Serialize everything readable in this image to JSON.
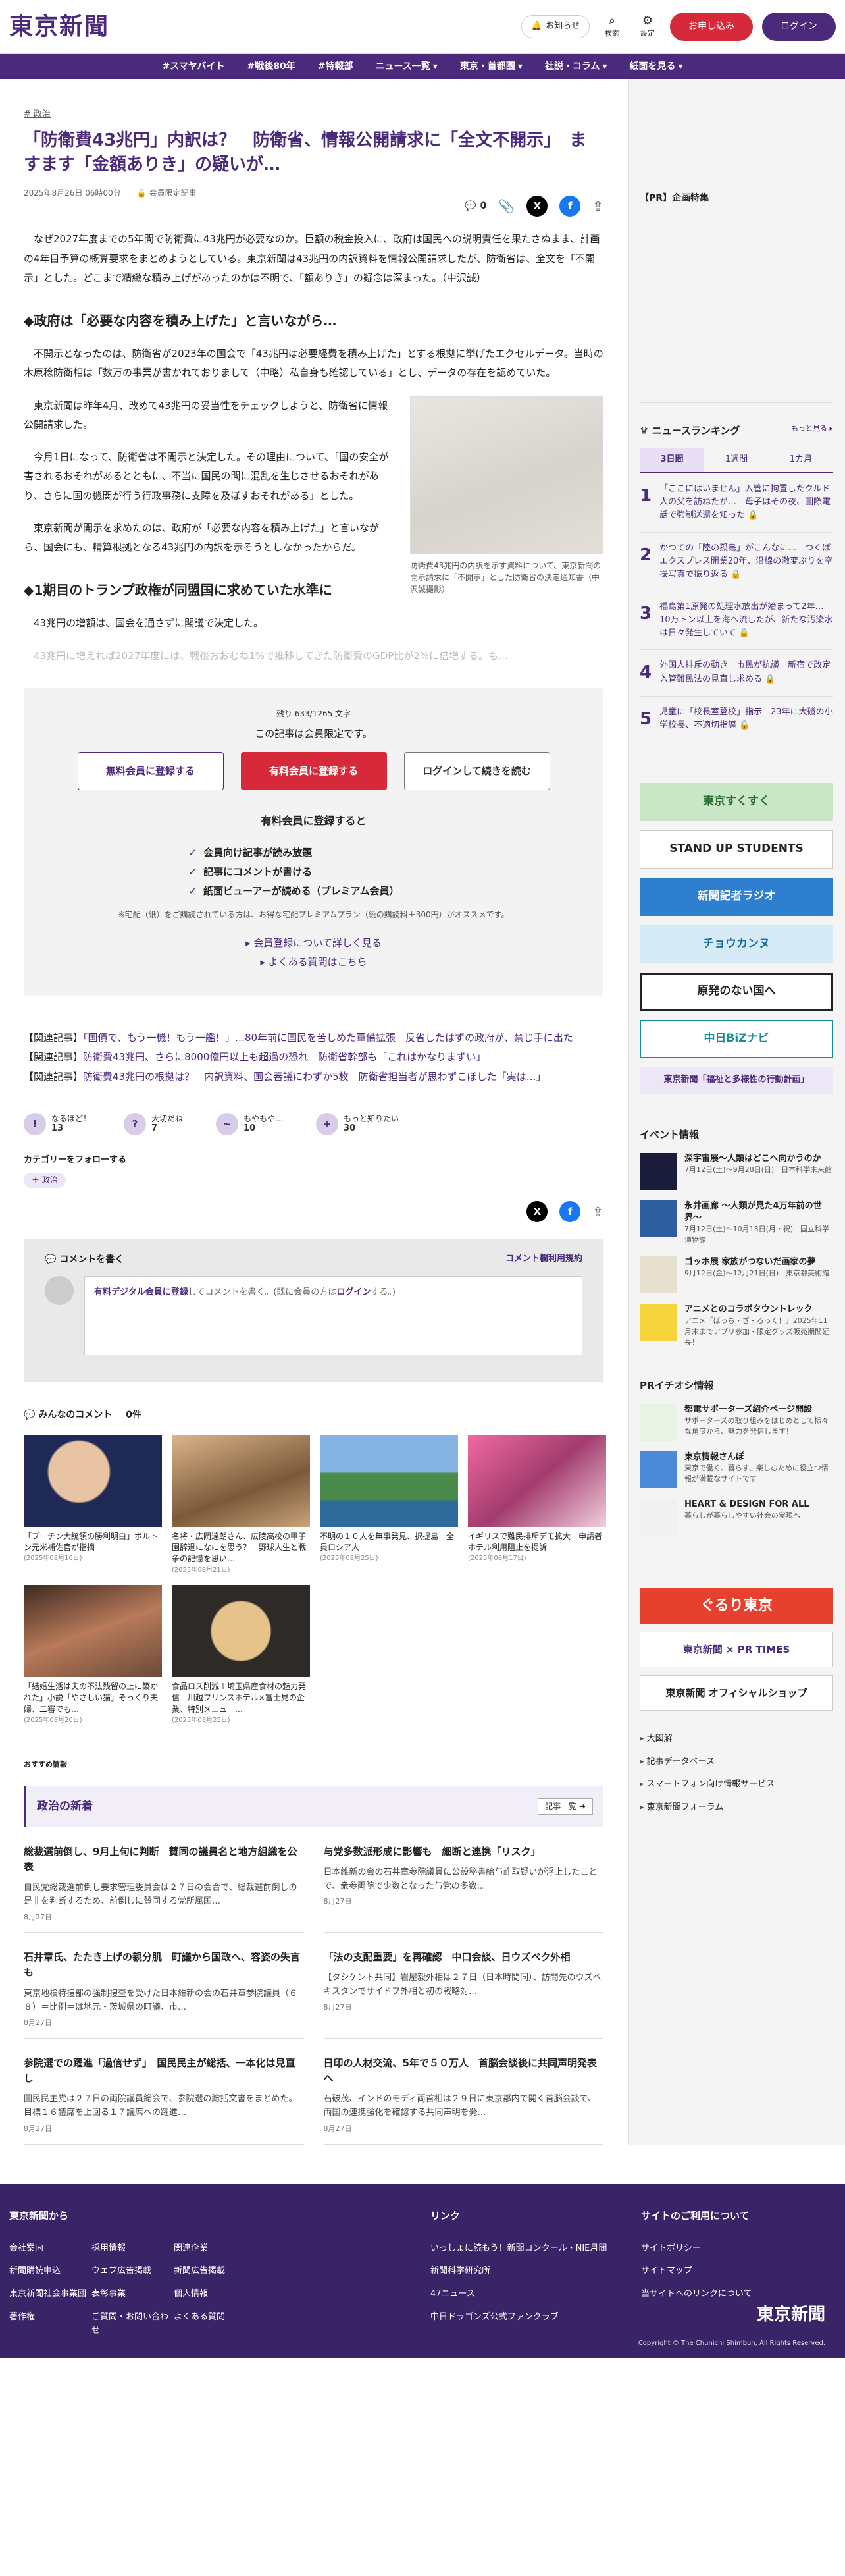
{
  "header": {
    "logo": "東京新聞",
    "notice": "お知らせ",
    "search": "検索",
    "settings": "設定",
    "register": "お申し込み",
    "login": "ログイン"
  },
  "nav": [
    "#スマヤバイト",
    "#戦後80年",
    "#特報部",
    "ニュース一覧",
    "東京・首都圏",
    "社説・コラム",
    "紙面を見る"
  ],
  "article": {
    "category": "政治",
    "title": "「防衛費43兆円」内訳は？　防衛省、情報公開請求に「全文不開示」　ますます「金額ありき」の疑いが…",
    "date": "2025年8月26日 06時00分",
    "members_only": "会員限定記事",
    "comment_count": "0",
    "lead": "なぜ2027年度までの5年間で防衛費に43兆円が必要なのか。巨額の税金投入に、政府は国民への説明責任を果たさぬまま、計画の4年目予算の概算要求をまとめようとしている。東京新聞は43兆円の内訳資料を情報公開請求したが、防衛省は、全文を「不開示」とした。どこまで精緻な積み上げがあったのかは不明で、「額ありき」の疑念は深まった。（中沢誠）",
    "h1": "◆政府は「必要な内容を積み上げた」と言いながら…",
    "p1": "不開示となったのは、防衛省が2023年の国会で「43兆円は必要経費を積み上げた」とする根拠に挙げたエクセルデータ。当時の木原稔防衛相は「数万の事業が書かれておりまして（中略）私自身も確認している」とし、データの存在を認めていた。",
    "p2": "東京新聞は昨年4月、改めて43兆円の妥当性をチェックしようと、防衛省に情報公開請求した。",
    "p3": "今月1日になって、防衛省は不開示と決定した。その理由について、「国の安全が害されるおそれがあるとともに、不当に国民の間に混乱を生じさせるおそれがあり、さらに国の機関が行う行政事務に支障を及ぼすおそれがある」とした。",
    "p4": "東京新聞が開示を求めたのは、政府が「必要な内容を積み上げた」と言いながら、国会にも、精算根拠となる43兆円の内訳を示そうとしなかったからだ。",
    "h2": "◆1期目のトランプ政権が同盟国に求めていた水準に",
    "p5": "43兆円の増額は、国会を通さずに閣議で決定した。",
    "p6": "43兆円に増えれば2027年度には、戦後おおむね1%で推移してきた防衛費のGDP比が2%に倍増する。も…",
    "figure_caption": "防衛費43兆円の内訳を示す資料について、東京新聞の開示請求に「不開示」とした防衛省の決定通知書（中沢誠撮影）"
  },
  "paywall": {
    "remaining": "残り 633/1265 文字",
    "title": "この記事は会員限定です。",
    "btn_free": "無料会員に登録する",
    "btn_paid": "有料会員に登録する",
    "btn_login": "ログインして続きを読む",
    "heading": "有料会員に登録すると",
    "benefits": [
      "会員向け記事が読み放題",
      "記事にコメントが書ける",
      "紙面ビューアーが読める（プレミアム会員）"
    ],
    "note": "※宅配（紙）をご購読されている方は、お得な宅配プレミアムプラン（紙の購読料＋300円）がオススメです。",
    "link1": "▸ 会員登録について詳しく見る",
    "link2": "▸ よくある質問はこちら"
  },
  "related": [
    {
      "prefix": "【関連記事】",
      "text": "「国債で、もう一機！もう一艦！」…80年前に国民を苦しめた軍備拡張　反省したはずの政府が、禁じ手に出た"
    },
    {
      "prefix": "【関連記事】",
      "text": "防衛費43兆円、さらに8000億円以上も超過の恐れ　防衛省幹部も「これはかなりまずい」"
    },
    {
      "prefix": "【関連記事】",
      "text": "防衛費43兆円の根拠は？　内訳資料、国会審議にわずか5枚　防衛省担当者が思わずこぼした「実は…」"
    }
  ],
  "reactions": [
    {
      "icon": "!",
      "label": "なるほど！",
      "count": "13"
    },
    {
      "icon": "?",
      "label": "大切だね",
      "count": "7"
    },
    {
      "icon": "~",
      "label": "もやもや…",
      "count": "10"
    },
    {
      "icon": "+",
      "label": "もっと知りたい",
      "count": "30"
    }
  ],
  "follow": {
    "title": "カテゴリーをフォローする",
    "chip": "＋ 政治"
  },
  "comment_box": {
    "title": "コメントを書く",
    "rules": "コメント欄利用規約",
    "prompt_strong": "有料デジタル会員に登録",
    "prompt_mid": "してコメントを書く。(既に会員の方は",
    "prompt_login": "ログイン",
    "prompt_end": "する。)"
  },
  "all_comments": {
    "label": "みんなのコメント",
    "count": "0件"
  },
  "photos": [
    {
      "caption": "「プーチン大統領の勝利明白」ボルトン元米補佐官が指摘",
      "date": "(2025年08月16日)"
    },
    {
      "caption": "名将・広岡達朗さん、広陵高校の甲子園辞退になにを思う？　野球人生と戦争の記憶を思い…",
      "date": "(2025年08月21日)"
    },
    {
      "caption": "不明の１０人を無事発見、択捉島　全員ロシア人",
      "date": "(2025年08月25日)"
    },
    {
      "caption": "イギリスで難民排斥デモ拡大　申請者ホテル利用阻止を提訴",
      "date": "(2025年08月17日)"
    },
    {
      "caption": "「結婚生活は夫の不法残留の上に築かれた」小説「やさしい猫」そっくり夫婦、二審でも…",
      "date": "(2025年08月20日)"
    },
    {
      "caption": "食品ロス削減＋埼玉県産食材の魅力発信　川越プリンスホテル×富士見の企業、特別メニュー…",
      "date": "(2025年08月25日)"
    }
  ],
  "reco_label": "おすすめ情報",
  "politics": {
    "title": "政治の新着",
    "more": "記事一覧 ➜",
    "items": [
      {
        "title": "総裁選前倒し、9月上旬に判断　賛同の議員名と地方組織を公表",
        "text": "自民党総裁選前倒し要求管理委員会は２７日の会合で、総裁選前倒しの是非を判断するため、前倒しに賛同する党所属国…",
        "date": "8月27日"
      },
      {
        "title": "与党多数派形成に影響も　細断と連携「リスク」",
        "text": "日本維新の会の石井章参院議員に公設秘書給与詐取疑いが浮上したことで、衆参両院で少数となった与党の多数…",
        "date": "8月27日"
      },
      {
        "title": "石井章氏、たたき上げの親分肌　町議から国政へ、容姿の失言も",
        "text": "東京地検特捜部の強制捜査を受けた日本維新の会の石井章参院議員（６８）＝比例＝は地元・茨城県の町議、市…",
        "date": "8月27日"
      },
      {
        "title": "「法の支配重要」を再確認　中口会談、日ウズベク外相",
        "text": "【タシケント共同】岩屋毅外相は２７日（日本時間同）、訪問先のウズベキスタンでサイドフ外相と初の戦略対…",
        "date": "8月27日"
      },
      {
        "title": "参院選での躍進「過信せず」　国民民主が総括、一本化は見直し",
        "text": "国民民主党は２７日の両院議員総会で、参院選の総括文書をまとめた。目標１６議席を上回る１７議席への躍進…",
        "date": "8月27日"
      },
      {
        "title": "日印の人材交流、5年で５０万人　首脳会談後に共同声明発表へ",
        "text": "石破茂、インドのモディ両首相は２９日に東京都内で開く首脳会談で、両国の連携強化を確認する共同声明を発…",
        "date": "8月27日"
      }
    ]
  },
  "sidebar": {
    "pr_title": "【PR】企画特集",
    "ranking_title": "ニュースランキング",
    "ranking_more": "もっと見る ▸",
    "tabs": [
      "3日間",
      "1週間",
      "1カ月"
    ],
    "ranking": [
      {
        "n": "1",
        "t": "「ここにはいません」入管に拘置したクルド人の父を訪ねたが…　母子はその夜、国際電話で強制送還を知った 🔒"
      },
      {
        "n": "2",
        "t": "かつての「陸の孤島」がこんなに…　つくばエクスプレス開業20年、沿線の激変ぶりを空撮写真で振り返る 🔒"
      },
      {
        "n": "3",
        "t": "福島第1原発の処理水放出が始まって2年…10万トン以上を海へ流したが、新たな汚染水は日々発生していて 🔒"
      },
      {
        "n": "4",
        "t": "外国人排斥の動き　市民が抗議　新宿で改定入管難民法の見直し求める 🔒"
      },
      {
        "n": "5",
        "t": "児童に「校長室登校」指示　23年に大磯の小学校長、不適切指導 🔒"
      }
    ],
    "banners": [
      "東京すくすく",
      "STAND UP STUDENTS",
      "新聞記者ラジオ",
      "チョウカンヌ",
      "原発のない国へ",
      "中日BiZナビ",
      "東京新聞「福祉と多様性の行動計画」"
    ],
    "events_title": "イベント情報",
    "events": [
      {
        "t": "深宇宙展〜人類はどこへ向かうのか",
        "s": "7月12日(土)〜9月28日(日)　日本科学未来館",
        "c": "#1b1b3a"
      },
      {
        "t": "永井画廊 〜人類が見た4万年前の世界〜",
        "s": "7月12日(土)〜10月13日(月・祝)　国立科学博物館",
        "c": "#2e5e9e"
      },
      {
        "t": "ゴッホ展 家族がつないだ画家の夢",
        "s": "9月12日(金)〜12月21日(日)　東京都美術館",
        "c": "#e7e0cf"
      },
      {
        "t": "アニメとのコラボタウントレック",
        "s": "アニメ「ぼっち・ざ・ろっく！」2025年11月末までアプリ参加・限定グッズ販売期間延長！",
        "c": "#f5d33a"
      }
    ],
    "pr_info_title": "PRイチオシ情報",
    "pr_info": [
      {
        "t": "都電サポーターズ紹介ページ開設",
        "s": "サポーターズの取り組みをはじめとして様々な角度から、魅力を発信します！",
        "c": "#e8f2e5"
      },
      {
        "t": "東京情報さんぽ",
        "s": "東京で働く、暮らす、楽しむために役立つ情報が満載なサイトです",
        "c": "#4a8ad6"
      },
      {
        "t": "HEART & DESIGN FOR ALL",
        "s": "暮らしが暮らしやすい社会の実現へ",
        "c": "#f0f0f0"
      }
    ],
    "bottom_banners": [
      "ぐるり東京",
      "東京新聞 × PR TIMES",
      "東京新聞 オフィシャルショップ"
    ],
    "links": [
      "大図解",
      "記事データベース",
      "スマートフォン向け情報サービス",
      "東京新聞フォーラム"
    ]
  },
  "footer": {
    "col1_title": "東京新聞から",
    "col1": [
      "会社案内",
      "採用情報",
      "関連企業",
      "新聞購読申込",
      "ウェブ広告掲載",
      "新聞広告掲載",
      "東京新聞社会事業団",
      "表彰事業",
      "個人情報",
      "著作権",
      "ご質問・お問い合わせ",
      "よくある質問"
    ],
    "col2_title": "リンク",
    "col2": [
      "いっしょに読もう！新聞コンクール・NIE月間",
      "新聞科学研究所",
      "47ニュース",
      "中日ドラゴンズ公式ファンクラブ"
    ],
    "col3_title": "サイトのご利用について",
    "col3": [
      "サイトポリシー",
      "サイトマップ",
      "当サイトへのリンクについて"
    ],
    "logo": "東京新聞",
    "copyright": "Copyright © The Chunichi Shimbun, All Rights Reserved."
  }
}
